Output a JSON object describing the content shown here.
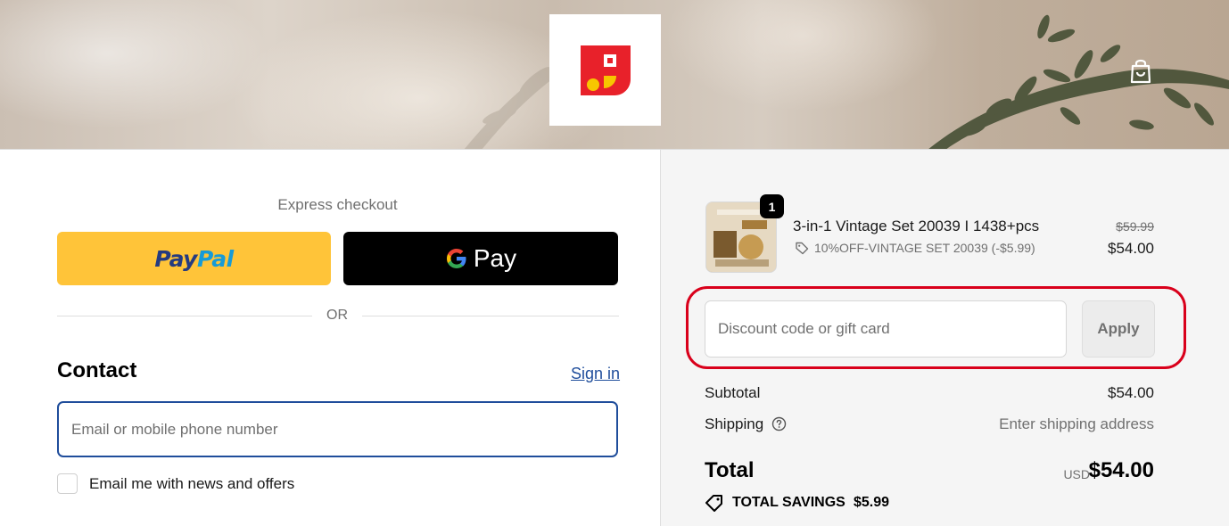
{
  "header": {
    "logo_icon": "store-logo",
    "cart_icon": "shopping-bag-icon"
  },
  "express": {
    "title": "Express checkout",
    "paypal": {
      "part1": "Pay",
      "part2": "Pal"
    },
    "gpay": {
      "label": "Pay",
      "icon": "google-g-icon"
    },
    "or_text": "OR"
  },
  "contact": {
    "title": "Contact",
    "sign_in": "Sign in",
    "email_placeholder": "Email or mobile phone number",
    "newsletter_label": "Email me with news and offers"
  },
  "order": {
    "item": {
      "quantity": "1",
      "name": "3-in-1 Vintage Set 20039 I 1438+pcs",
      "discount": "10%OFF-VINTAGE SET 20039 (-$5.99)",
      "price_old": "$59.99",
      "price_new": "$54.00"
    },
    "discount_placeholder": "Discount code or gift card",
    "apply_label": "Apply",
    "subtotal_label": "Subtotal",
    "subtotal_value": "$54.00",
    "shipping_label": "Shipping",
    "shipping_value": "Enter shipping address",
    "total_label": "Total",
    "total_currency": "USD",
    "total_value": "$54.00",
    "savings_label": "TOTAL SAVINGS",
    "savings_value": "$5.99"
  },
  "colors": {
    "paypal_yellow": "#ffc439",
    "link_blue": "#1f4d9b",
    "highlight_red": "#d9001b",
    "logo_red": "#e8212a",
    "logo_yellow": "#f7c600"
  }
}
